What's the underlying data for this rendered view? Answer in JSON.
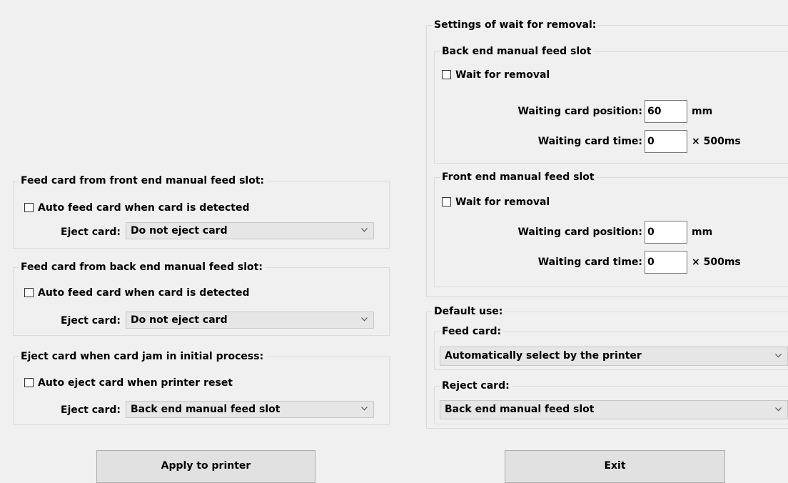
{
  "front_feed": {
    "legend": "Feed card from front end manual feed slot:",
    "auto_label": "Auto feed card when card is detected",
    "eject_label": "Eject card:",
    "eject_value": "Do not eject card"
  },
  "back_feed": {
    "legend": "Feed card from back end manual feed slot:",
    "auto_label": "Auto feed card when card is detected",
    "eject_label": "Eject card:",
    "eject_value": "Do not eject card"
  },
  "jam": {
    "legend": "Eject card when card jam in initial process:",
    "auto_label": "Auto eject card when printer reset",
    "eject_label": "Eject card:",
    "eject_value": "Back end manual feed slot"
  },
  "removal": {
    "legend": "Settings of wait for removal:",
    "back": {
      "legend": "Back end manual feed slot",
      "wait_label": "Wait for removal",
      "pos_label": "Waiting card position:",
      "pos_value": "60",
      "pos_unit": "mm",
      "time_label": "Waiting card time:",
      "time_value": "0",
      "time_unit": "× 500ms"
    },
    "front": {
      "legend": "Front end manual feed slot",
      "wait_label": "Wait for removal",
      "pos_label": "Waiting card position:",
      "pos_value": "0",
      "pos_unit": "mm",
      "time_label": "Waiting card time:",
      "time_value": "0",
      "time_unit": "× 500ms"
    }
  },
  "default_use": {
    "legend": "Default use:",
    "feed_legend": "Feed card:",
    "feed_value": "Automatically select by the printer",
    "reject_legend": "Reject card:",
    "reject_value": "Back end manual feed slot"
  },
  "buttons": {
    "apply": "Apply to printer",
    "exit": "Exit"
  }
}
